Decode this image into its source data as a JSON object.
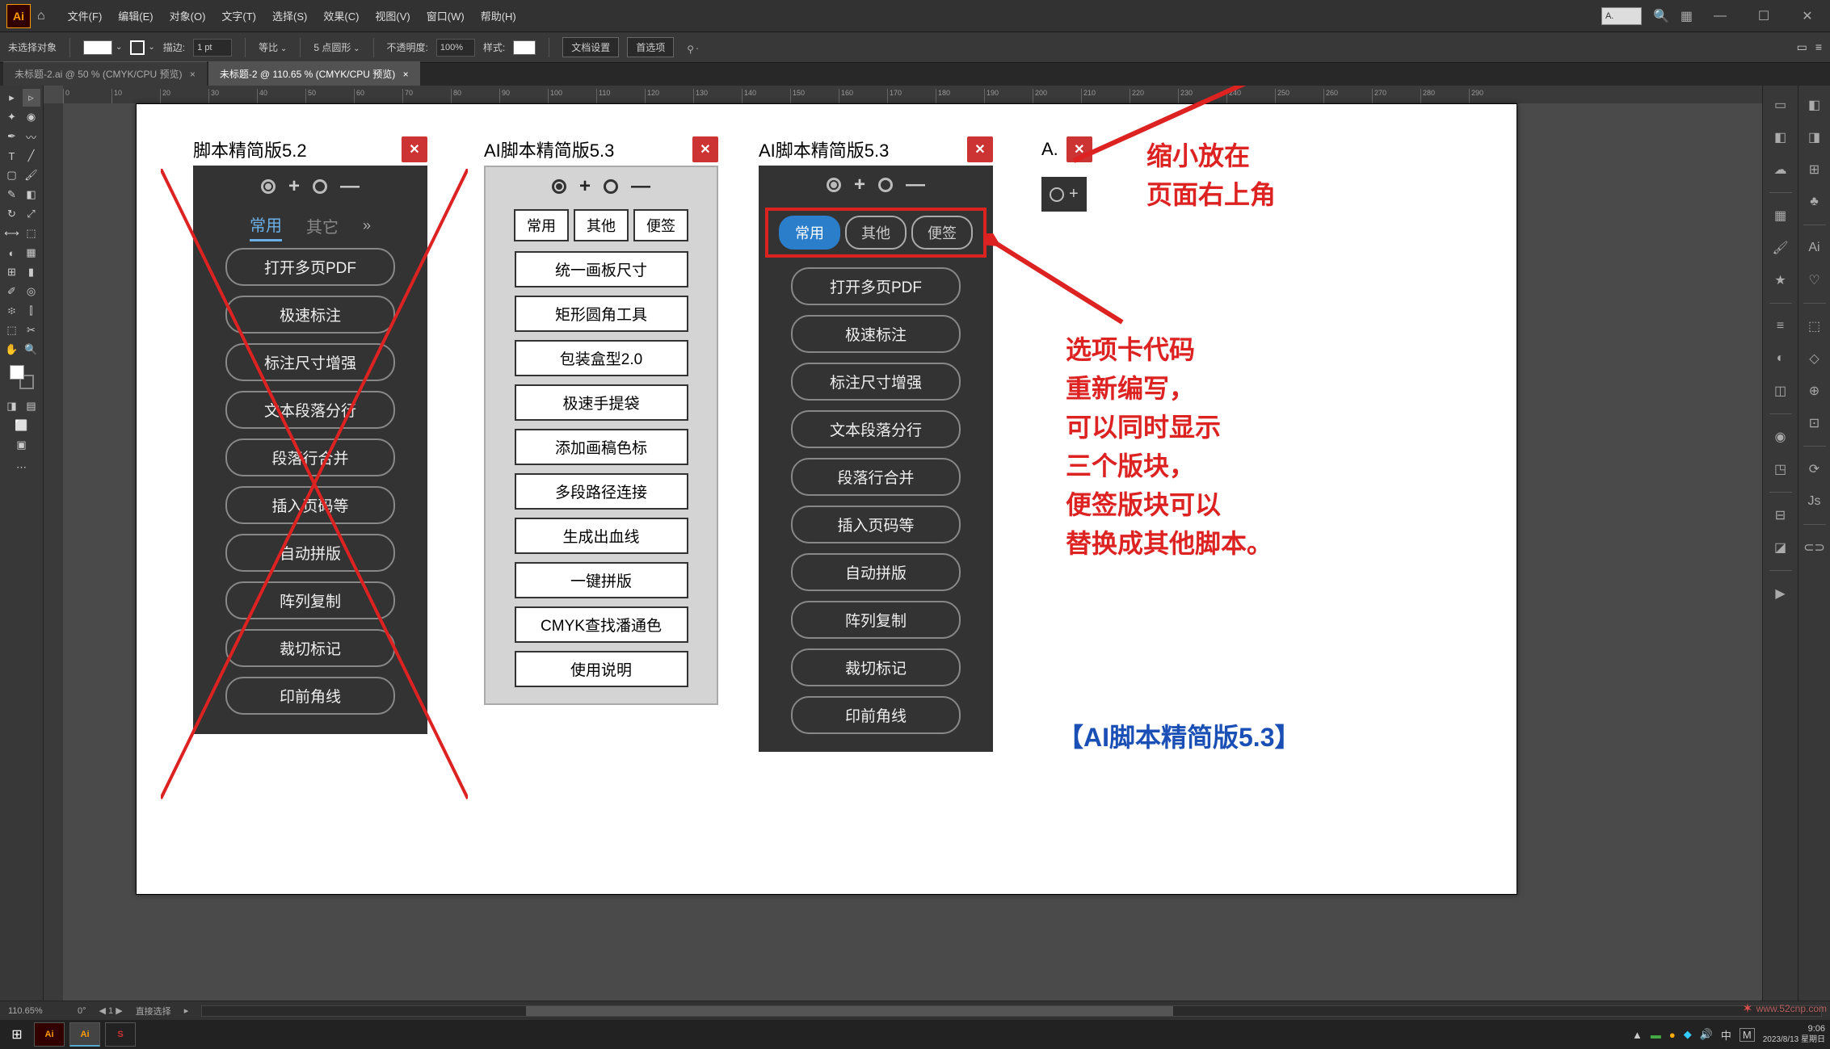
{
  "app": {
    "logo": "Ai",
    "title": "A."
  },
  "menu": [
    "文件(F)",
    "编辑(E)",
    "对象(O)",
    "文字(T)",
    "选择(S)",
    "效果(C)",
    "视图(V)",
    "窗口(W)",
    "帮助(H)"
  ],
  "options": {
    "no_selection": "未选择对象",
    "stroke_label": "描边:",
    "stroke_value": "1 pt",
    "uniform": "等比",
    "brush_label": "5 点圆形",
    "opacity_label": "不透明度:",
    "opacity_value": "100%",
    "style_label": "样式:",
    "doc_setup": "文档设置",
    "prefs": "首选项"
  },
  "tabs": [
    "未标题-2.ai @ 50 % (CMYK/CPU 预览)",
    "未标题-2 @ 110.65 % (CMYK/CPU 预览)"
  ],
  "active_tab": 1,
  "ruler_ticks": [
    "0",
    "10",
    "20",
    "30",
    "40",
    "50",
    "60",
    "70",
    "80",
    "90",
    "100",
    "110",
    "120",
    "130",
    "140",
    "150",
    "160",
    "170",
    "180",
    "190",
    "200",
    "210",
    "220",
    "230",
    "240",
    "250",
    "260",
    "270",
    "280",
    "290"
  ],
  "panel52": {
    "title": "脚本精简版5.2",
    "tabs": [
      "常用",
      "其它"
    ],
    "buttons": [
      "打开多页PDF",
      "极速标注",
      "标注尺寸增强",
      "文本段落分行",
      "段落行合并",
      "插入页码等",
      "自动拼版",
      "阵列复制",
      "裁切标记",
      "印前角线"
    ]
  },
  "panel53_light": {
    "title": "AI脚本精简版5.3",
    "tabs": [
      "常用",
      "其他",
      "便签"
    ],
    "buttons": [
      "统一画板尺寸",
      "矩形圆角工具",
      "包装盒型2.0",
      "极速手提袋",
      "添加画稿色标",
      "多段路径连接",
      "生成出血线",
      "一键拼版",
      "CMYK查找潘通色",
      "使用说明"
    ]
  },
  "panel53_dark": {
    "title": "AI脚本精简版5.3",
    "tabs": [
      "常用",
      "其他",
      "便签"
    ],
    "buttons": [
      "打开多页PDF",
      "极速标注",
      "标注尺寸增强",
      "文本段落分行",
      "段落行合并",
      "插入页码等",
      "自动拼版",
      "阵列复制",
      "裁切标记",
      "印前角线"
    ]
  },
  "mini_panel_label": "A.",
  "annotations": {
    "top": "缩小放在\n页面右上角",
    "mid": "选项卡代码\n重新编写，\n可以同时显示\n三个版块，\n便签版块可以\n替换成其他脚本。",
    "bottom": "【AI脚本精简版5.3】"
  },
  "status": {
    "zoom": "110.65%",
    "angle": "0°",
    "nav": "1",
    "mode": "直接选择"
  },
  "taskbar": {
    "time": "9:06",
    "date": "2023/8/13 星期日",
    "ime": "中"
  },
  "watermark": "www.52cnp.com"
}
